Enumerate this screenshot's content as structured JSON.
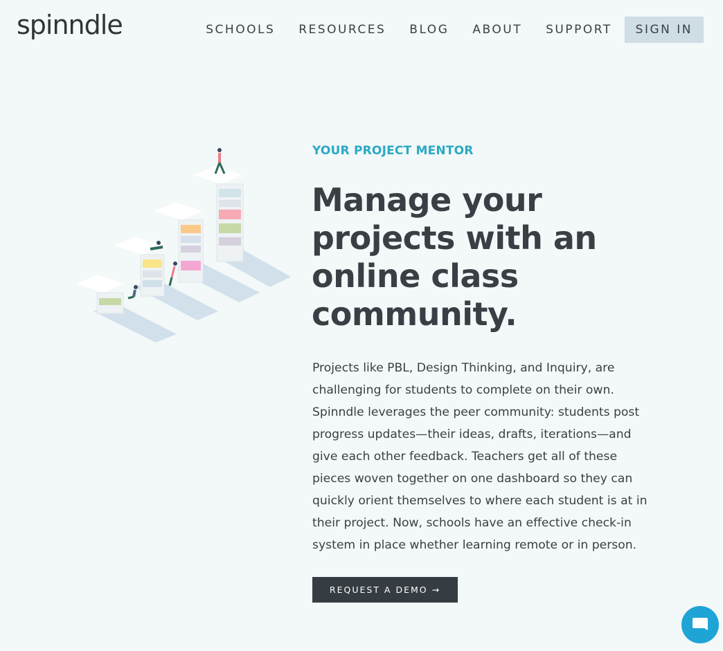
{
  "brand": {
    "logo_text": "spinndle"
  },
  "nav": {
    "items": [
      "SCHOOLS",
      "RESOURCES",
      "BLOG",
      "ABOUT",
      "SUPPORT"
    ],
    "signin_label": "SIGN IN"
  },
  "hero": {
    "kicker": "YOUR PROJECT MENTOR",
    "headline": "Manage your projects with an online class community.",
    "body": "Projects like PBL, Design Thinking, and Inquiry, are challenging for students to complete on their own. Spinndle leverages the peer community: students post progress updates—their ideas, drafts, iterations—and give each other feedback. Teachers get all of these pieces woven together on one dashboard so they can quickly orient themselves to where each student is at in their project. Now, schools have an effective check-in system in place whether learning remote or in person.",
    "cta_label": "REQUEST A DEMO →"
  },
  "colors": {
    "background": "#f3f8f8",
    "accent": "#2aa9c4",
    "text": "#3a3f45",
    "cta_bg": "#353c42",
    "signin_bg": "#cfdde5",
    "chat_bg": "#1fa4d6"
  },
  "icons": {
    "illustration": "project-stairs-illustration",
    "chat": "chat-bubble-icon"
  }
}
